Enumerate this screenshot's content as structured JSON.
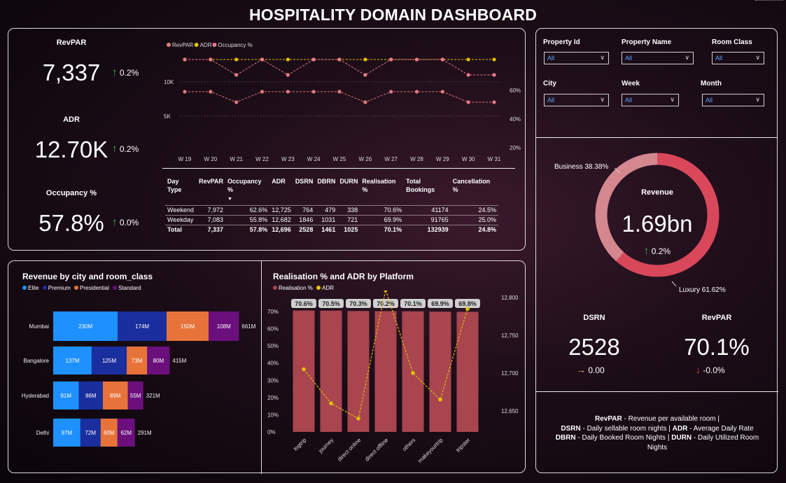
{
  "title": "HOSPITALITY DOMAIN DASHBOARD",
  "kpis": {
    "revpar": {
      "label": "RevPAR",
      "value": "7,337",
      "delta": "0.2%"
    },
    "adr": {
      "label": "ADR",
      "value": "12.70K",
      "delta": "0.2%"
    },
    "occupancy": {
      "label": "Occupancy %",
      "value": "57.8%",
      "delta": "0.0%"
    }
  },
  "trend_chart": {
    "legend": [
      "RevPAR",
      "ADR",
      "Occupancy %"
    ],
    "colors": {
      "revpar": "#e07a7a",
      "adr": "#e5c000",
      "occupancy": "#e87a86"
    },
    "y_left_ticks": [
      "10K",
      "5K"
    ],
    "y_right_ticks": [
      "60%",
      "40%",
      "20%",
      "0%"
    ]
  },
  "chart_data": [
    {
      "type": "line",
      "x": [
        "W 19",
        "W 20",
        "W 21",
        "W 22",
        "W 23",
        "W 24",
        "W 25",
        "W 26",
        "W 27",
        "W 28",
        "W 29",
        "W 30",
        "W 31"
      ],
      "series": [
        {
          "name": "ADR",
          "axis": "left",
          "values": [
            12700,
            12700,
            12650,
            12700,
            12700,
            12700,
            12700,
            12700,
            12700,
            12700,
            12650,
            12700,
            12700
          ]
        },
        {
          "name": "RevPAR",
          "axis": "left",
          "values": [
            7900,
            7900,
            6800,
            7900,
            7900,
            7900,
            7900,
            6800,
            7900,
            7900,
            7900,
            6800,
            6800
          ]
        },
        {
          "name": "Occupancy %",
          "axis": "right",
          "values": [
            62,
            62,
            51,
            62,
            51,
            62,
            62,
            51,
            62,
            62,
            62,
            51,
            51
          ]
        }
      ],
      "ylim_left": [
        0,
        13000
      ],
      "ylim_right": [
        0,
        65
      ]
    },
    {
      "type": "bar",
      "orientation": "horizontal",
      "stacked": true,
      "title": "Revenue by city and room_class",
      "categories": [
        "Mumbai",
        "Bangalore",
        "Hyderabad",
        "Delhi"
      ],
      "series": [
        {
          "name": "Elite",
          "values": [
            230,
            137,
            91,
            97
          ]
        },
        {
          "name": "Premium",
          "values": [
            174,
            125,
            86,
            72
          ]
        },
        {
          "name": "Presidential",
          "values": [
            150,
            73,
            89,
            60
          ]
        },
        {
          "name": "Standard",
          "values": [
            108,
            80,
            55,
            62
          ]
        }
      ],
      "totals": [
        "661M",
        "415M",
        "321M",
        "291M"
      ],
      "labels": [
        [
          "230M",
          "174M",
          "150M",
          "108M"
        ],
        [
          "137M",
          "125M",
          "73M",
          "80M"
        ],
        [
          "91M",
          "86M",
          "89M",
          "55M"
        ],
        [
          "97M",
          "72M",
          "60M",
          "62M"
        ]
      ],
      "colors": [
        "#1e90ff",
        "#1a2e9e",
        "#e8733a",
        "#6b0f7d"
      ]
    },
    {
      "type": "bar",
      "title": "Realisation % and ADR by Platform",
      "categories": [
        "logtrip",
        "journey",
        "direct online",
        "direct offline",
        "others",
        "makeyourtrip",
        "tripster"
      ],
      "series": [
        {
          "name": "Realisation %",
          "values": [
            70.6,
            70.5,
            70.3,
            70.2,
            70.1,
            69.9,
            69.8
          ],
          "labels": [
            "70.6%",
            "70.5%",
            "70.3%",
            "70.2%",
            "70.1%",
            "69.9%",
            "69.8%"
          ]
        },
        {
          "name": "ADR",
          "type": "line",
          "values": [
            12705,
            12660,
            12640,
            12810,
            12700,
            12665,
            12785
          ]
        }
      ],
      "y_left_ticks": [
        "70%",
        "60%",
        "50%",
        "40%",
        "30%",
        "20%",
        "10%",
        "0%"
      ],
      "y_right_ticks": [
        "12,800",
        "12,750",
        "12,700",
        "12,650"
      ],
      "ylim_right": [
        12620,
        12800
      ],
      "colors": {
        "bar": "#a8454f",
        "line": "#e5c000"
      }
    },
    {
      "type": "pie",
      "title": "Revenue",
      "labels": [
        "Business 38.38%",
        "Luxury 61.62%"
      ],
      "values": [
        38.38,
        61.62
      ],
      "colors": [
        "#d4878e",
        "#d9475a"
      ]
    }
  ],
  "day_table": {
    "headers": [
      "Day Type",
      "RevPAR",
      "Occupancy %",
      "ADR",
      "DSRN",
      "DBRN",
      "DURN",
      "Realisation %",
      "Total Bookings",
      "Cancellation %"
    ],
    "rows": [
      [
        "Weekend",
        "7,972",
        "62.6%",
        "12,725",
        "764",
        "479",
        "338",
        "70.6%",
        "41174",
        "24.5%"
      ],
      [
        "Weekday",
        "7,083",
        "55.8%",
        "12,682",
        "1846",
        "1031",
        "721",
        "69.9%",
        "91765",
        "25.0%"
      ],
      [
        "Total",
        "7,337",
        "57.8%",
        "12,696",
        "2528",
        "1461",
        "1025",
        "70.1%",
        "132939",
        "24.8%"
      ]
    ]
  },
  "filters": [
    {
      "label": "Property Id",
      "value": "All"
    },
    {
      "label": "Property Name",
      "value": "All"
    },
    {
      "label": "Room Class",
      "value": "All"
    },
    {
      "label": "City",
      "value": "All"
    },
    {
      "label": "Week",
      "value": "All"
    },
    {
      "label": "Month",
      "value": "All"
    }
  ],
  "donut": {
    "center_label": "Revenue",
    "value": "1.69bn",
    "delta": "0.2%",
    "business": "Business 38.38%",
    "luxury": "Luxury 61.62%"
  },
  "small_kpis": {
    "dsrn": {
      "label": "DSRN",
      "value": "2528",
      "delta": "0.00"
    },
    "revpar": {
      "label": "RevPAR",
      "value": "70.1%",
      "delta": "-0.0%"
    }
  },
  "glossary": {
    "l1a": "RevPAR",
    "l1b": " - Revenue per available room |",
    "l2a": "DSRN",
    "l2b": " - Daily sellable room nights | ",
    "l2c": "ADR",
    "l2d": " - Average Daily Rate",
    "l3a": "DBRN",
    "l3b": " - Daily Booked Room Nights | ",
    "l3c": "DURN",
    "l3d": " - Daily Utilized Room",
    "l4": "Nights"
  }
}
